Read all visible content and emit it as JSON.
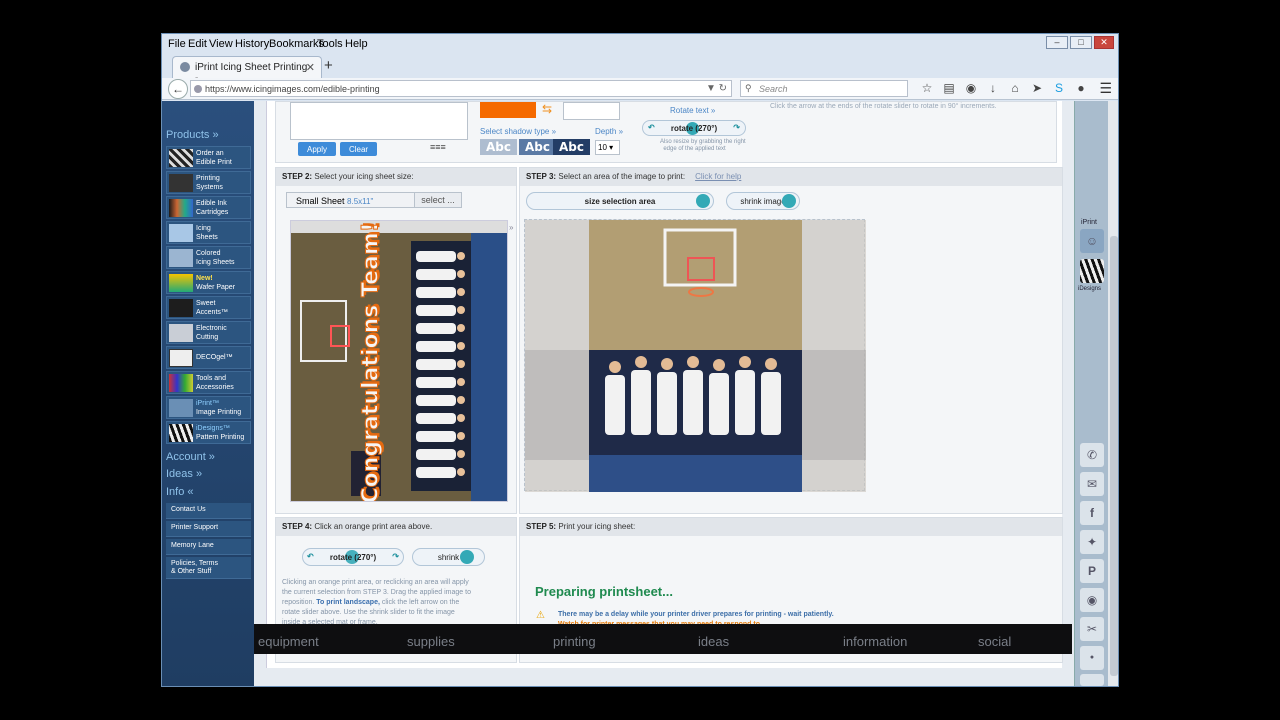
{
  "browser": {
    "menu": [
      "File",
      "Edit",
      "View",
      "History",
      "Bookmarks",
      "Tools",
      "Help"
    ],
    "tab_title": "iPrint Icing Sheet Printing -...",
    "url": "https://www.icingimages.com/edible-printing",
    "search_placeholder": "Search"
  },
  "leftnav": {
    "products_label": "Products »",
    "items": [
      {
        "line1": "Order an",
        "line2": "Edible Print"
      },
      {
        "line1": "Printing",
        "line2": "Systems"
      },
      {
        "line1": "Edible Ink",
        "line2": "Cartridges"
      },
      {
        "line1": "Icing",
        "line2": "Sheets"
      },
      {
        "line1": "Colored",
        "line2": "Icing Sheets"
      },
      {
        "line1": "New!",
        "line2": "Wafer Paper"
      },
      {
        "line1": "Sweet",
        "line2": "Accents™"
      },
      {
        "line1": "Electronic",
        "line2": "Cutting"
      },
      {
        "line1": "DECOgel™",
        "line2": ""
      },
      {
        "line1": "Tools and",
        "line2": "Accessories"
      },
      {
        "line1": "iPrint™",
        "line2": "Image Printing"
      },
      {
        "line1": "iDesigns™",
        "line2": "Pattern Printing"
      }
    ],
    "account_label": "Account »",
    "ideas_label": "Ideas »",
    "info_label": "Info «",
    "info_items": [
      "Contact Us",
      "Printer Support",
      "Memory Lane",
      "Policies, Terms",
      "& Other Stuff"
    ]
  },
  "top": {
    "apply": "Apply",
    "clear": "Clear",
    "shadow_label": "Select shadow type »",
    "abc": "Abc",
    "depth_label": "Depth »",
    "depth_value": "10",
    "rotate_text_label": "Rotate text »",
    "rotate_pill": "rotate (270°)",
    "rotate_hint_1": "Also resize by grabbing the right",
    "rotate_hint_2": "edge of the applied text",
    "arrow_hint": "Click the arrow at the ends of the rotate slider to rotate in 90° increments."
  },
  "step2": {
    "step": "STEP 2:",
    "label": "Select your icing sheet size:",
    "sheet_name": "Small Sheet",
    "sheet_size": "8.5x11\"",
    "select": "select ..."
  },
  "step3": {
    "step": "STEP 3:",
    "label": "Select an area of the image to print:",
    "help": "Click for help",
    "size_area": "size selection area",
    "shrink_image": "shrink image"
  },
  "step4": {
    "step": "STEP 4:",
    "label": "Click an orange print area above.",
    "rotate_pill": "rotate (270°)",
    "shrink": "shrink",
    "text_1": "Clicking an orange print area, or reclicking an area will apply",
    "text_2": "the current selection from STEP 3. Drag the applied image to",
    "text_3a": "reposition.",
    "text_3b": "To print landscape,",
    "text_3c": "click the left arrow on the",
    "text_4": "rotate slider above. Use the shrink slider to fit the image",
    "text_5": "inside a selected mat or frame."
  },
  "step5": {
    "step": "STEP 5:",
    "label": "Print your icing sheet:",
    "preparing": "Preparing printsheet...",
    "warn_1": "There may be a delay while your printer driver prepares for printing - wait patiently.",
    "warn_2": "Watch for printer messages that you may need to respond to."
  },
  "photo_text": "Congratulations Team!",
  "rightbar": {
    "iprint": "iPrint",
    "idesigns": "iDesigns"
  },
  "footer": [
    "equipment",
    "supplies",
    "printing",
    "ideas",
    "information",
    "social"
  ],
  "colors": {
    "accent": "#f56a00",
    "nav": "#2a4f7d",
    "button": "#3d8bd9",
    "success": "#1f8a4f"
  }
}
